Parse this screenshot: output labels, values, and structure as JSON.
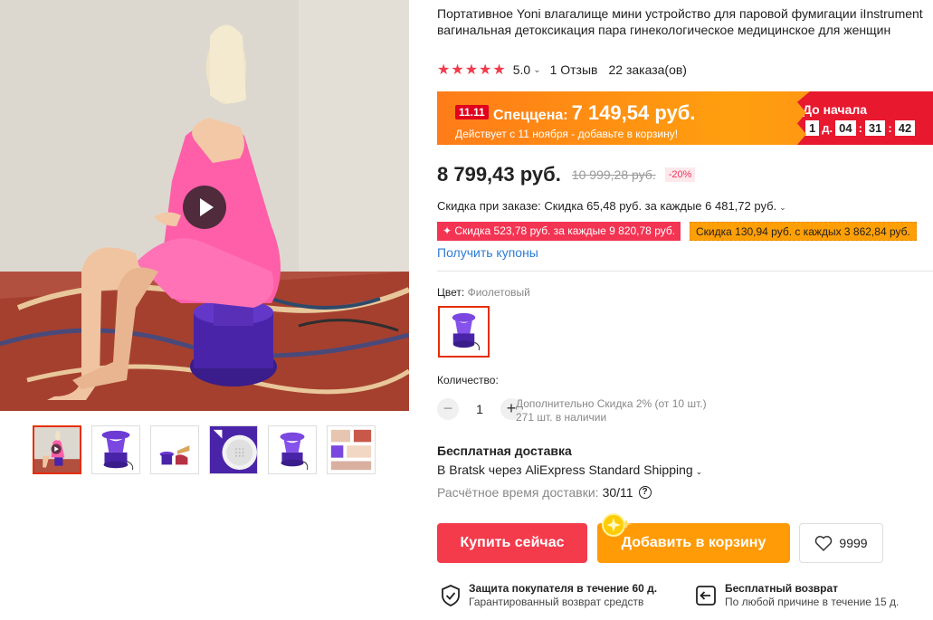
{
  "product": {
    "title": "Портативное Yoni влагалище мини устройство для паровой фумигации iInstrument вагинальная детоксикация пара гинекологическое медицинское для женщин",
    "stars": "★★★★★",
    "rating": "5.0",
    "rating_chevron": "⌄",
    "reviews": "1 Отзыв",
    "orders": "22 заказа(ов)"
  },
  "promo": {
    "badge": "11.11",
    "label": "Спеццена:",
    "amount": "7 149,54 руб.",
    "note": "Действует с 11 ноября - добавьте в корзину!",
    "countdown_title": "До начала",
    "days": "1",
    "days_unit": "д.",
    "hours": "04",
    "minutes": "31",
    "seconds": "42",
    "colors": {
      "bar": "#ff9f0e",
      "countdown": "#e8182e"
    }
  },
  "price": {
    "current": "8 799,43 руб.",
    "original": "10 999,28 руб.",
    "discount": "-20%"
  },
  "order_discount": {
    "text": "Скидка при заказе: Скидка 65,48 руб. за каждые 6 481,72 руб."
  },
  "coupons": {
    "red": "✦ Скидка 523,78 руб. за каждые 9 820,78 руб.",
    "orange": "Скидка 130,94 руб. с каждых 3 862,84 руб.",
    "link": "Получить купоны"
  },
  "color": {
    "label": "Цвет:",
    "value": "Фиолетовый",
    "selected_icon": "purple-steamer"
  },
  "quantity": {
    "label": "Количество:",
    "minus": "−",
    "plus": "+",
    "value": "1",
    "extra_discount": "Дополнительно Скидка 2% (от 10 шт.)",
    "stock": "271 шт. в наличии"
  },
  "shipping": {
    "title": "Бесплатная доставка",
    "via": "В Bratsk через AliExpress Standard Shipping",
    "eta_label": "Расчётное время доставки:",
    "eta_value": "30/11",
    "help_icon": "?"
  },
  "actions": {
    "buy_now": "Купить сейчас",
    "add_to_cart": "Добавить в корзину",
    "wishlist_count": "9999"
  },
  "guarantees": [
    {
      "title": "Защита покупателя в течение 60 д.",
      "subtitle": "Гарантированный возврат средств",
      "icon": "shield-check-icon"
    },
    {
      "title": "Бесплатный возврат",
      "subtitle": "По любой причине в течение 15 д.",
      "icon": "return-icon"
    }
  ],
  "gallery": {
    "thumbnails": [
      "woman-sitting",
      "steamer-front",
      "steamer-with-towel",
      "steamer-lid",
      "steamer-purple",
      "info-collage"
    ],
    "active_index": 0
  },
  "colors": {
    "accent_red": "#f33b4c",
    "accent_orange": "#ff9b07",
    "link_blue": "#2e7cd4"
  }
}
